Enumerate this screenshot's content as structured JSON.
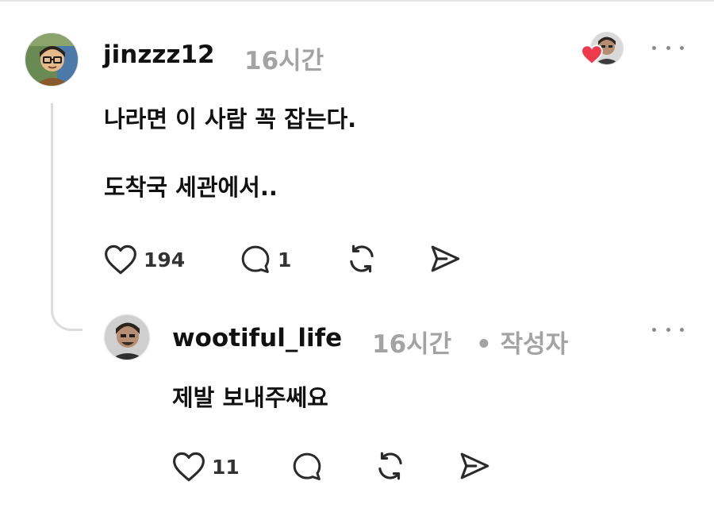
{
  "comment": {
    "username": "jinzzz12",
    "time": "16시간",
    "lines": [
      "나라면 이 사람 꼭 잡는다.",
      "도착국 세관에서.."
    ],
    "like_count": "194",
    "reply_count": "1"
  },
  "reply": {
    "username": "wootiful_life",
    "time": "16시간",
    "author_badge": "• 작성자",
    "text": "제발 보내주쎄요",
    "like_count": "11"
  },
  "icons": {
    "like": "heart-outline-icon",
    "reply": "speech-bubble-icon",
    "repost": "repost-icon",
    "share": "send-icon",
    "more": "more-dots-icon",
    "liked_by_author": "red-heart-icon"
  },
  "colors": {
    "text": "#111111",
    "meta": "#a3a3a3",
    "icon": "#2a2a2a",
    "heart": "#ef3a4e",
    "thread_line": "#dcdcdc"
  }
}
